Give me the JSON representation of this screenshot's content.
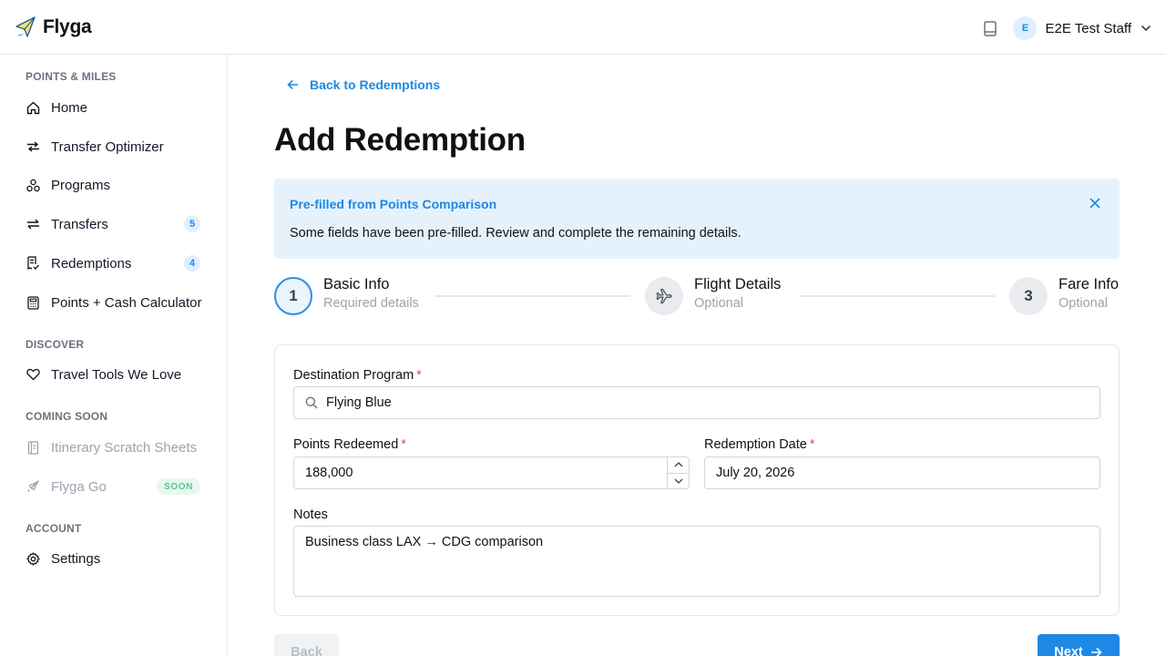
{
  "app": {
    "name": "Flyga",
    "logo_icon": "paper-plane-icon",
    "user_initial": "E",
    "user_name": "E2E Test Staff"
  },
  "sidebar": {
    "sections": [
      {
        "title": "POINTS & MILES",
        "items": [
          {
            "label": "Home",
            "icon": "home-icon"
          },
          {
            "label": "Transfer Optimizer",
            "icon": "transfer-icon"
          },
          {
            "label": "Programs",
            "icon": "programs-icon"
          },
          {
            "label": "Transfers",
            "icon": "transfers-icon",
            "badge": "5"
          },
          {
            "label": "Redemptions",
            "icon": "receipt-icon",
            "badge": "4"
          },
          {
            "label": "Points + Cash Calculator",
            "icon": "calculator-icon"
          }
        ]
      },
      {
        "title": "DISCOVER",
        "items": [
          {
            "label": "Travel Tools We Love",
            "icon": "heart-icon"
          }
        ]
      },
      {
        "title": "COMING SOON",
        "items": [
          {
            "label": "Itinerary Scratch Sheets",
            "icon": "notebook-icon"
          },
          {
            "label": "Flyga Go",
            "icon": "rocket-icon",
            "tag": "SOON"
          }
        ]
      },
      {
        "title": "ACCOUNT",
        "items": [
          {
            "label": "Settings",
            "icon": "gear-icon"
          }
        ]
      }
    ]
  },
  "main": {
    "back_link": "Back to Redemptions",
    "title": "Add Redemption",
    "alert": {
      "title": "Pre-filled from Points Comparison",
      "message": "Some fields have been pre-filled. Review and complete the remaining details."
    },
    "steps": [
      {
        "number": "1",
        "title": "Basic Info",
        "subtitle": "Required details",
        "state": "active"
      },
      {
        "number": "",
        "icon": "plane-icon",
        "title": "Flight Details",
        "subtitle": "Optional",
        "state": "idle"
      },
      {
        "number": "3",
        "title": "Fare Info",
        "subtitle": "Optional",
        "state": "idle"
      }
    ],
    "form": {
      "destination_program": {
        "label": "Destination Program",
        "required_mark": "*",
        "value": "Flying Blue"
      },
      "points_redeemed": {
        "label": "Points Redeemed",
        "required_mark": "*",
        "value": "188,000"
      },
      "redemption_date": {
        "label": "Redemption Date",
        "required_mark": "*",
        "value": "July 20, 2026"
      },
      "notes": {
        "label": "Notes",
        "value": "Business class LAX → CDG comparison"
      }
    },
    "buttons": {
      "back": "Back",
      "next": "Next"
    }
  },
  "colors": {
    "accent": "#1e88e5",
    "alert_bg": "#e6f2fb",
    "required": "#ef4444"
  }
}
